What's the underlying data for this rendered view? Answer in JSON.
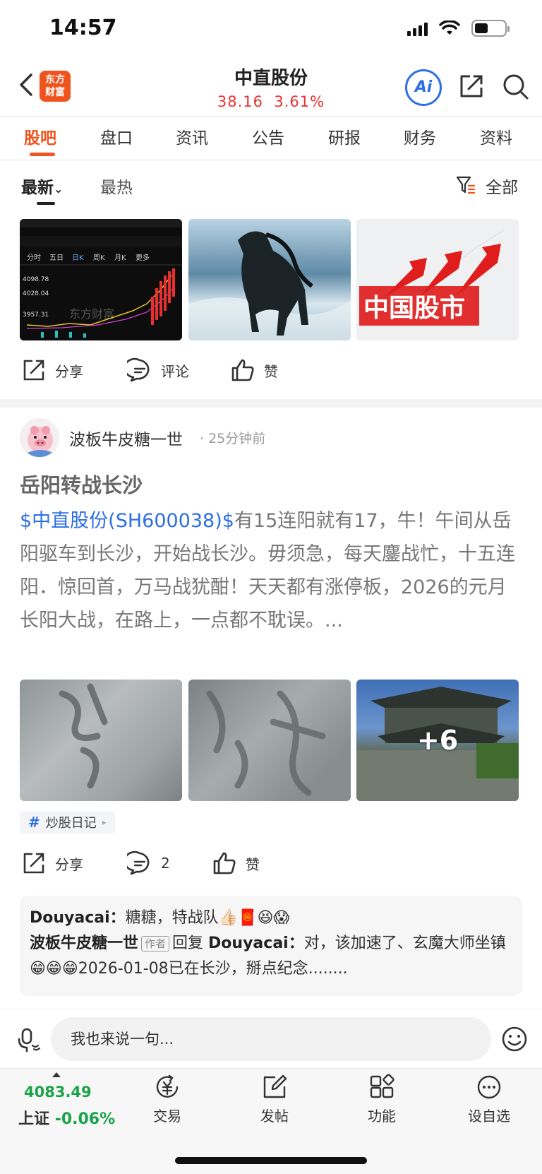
{
  "status_bar": {
    "time": "14:57"
  },
  "header": {
    "logo_text_line1": "东方",
    "logo_text_line2": "财富",
    "stock_name": "中直股份",
    "stock_price": "38.16",
    "stock_change": "3.61%",
    "ai_label": "Ai"
  },
  "tabs": [
    {
      "label": "股吧",
      "active": true
    },
    {
      "label": "盘口"
    },
    {
      "label": "资讯"
    },
    {
      "label": "公告"
    },
    {
      "label": "研报"
    },
    {
      "label": "财务"
    },
    {
      "label": "资料"
    }
  ],
  "sub_filter": {
    "latest": "最新",
    "hot": "最热",
    "all": "全部"
  },
  "post1": {
    "chart_thumb_watermark": "东方财富",
    "chart_thumb_price_high": "4098.78",
    "chart_thumb_price_mid": "4028.04",
    "chart_thumb_price_low": "3957.31",
    "chart_thumb_tabs": [
      "分时",
      "五日",
      "日K",
      "周K",
      "月K",
      "更多"
    ],
    "stock_thumb_title": "中国股市",
    "actions": {
      "share": "分享",
      "comment": "评论",
      "like": "赞"
    }
  },
  "post2": {
    "author": "波板牛皮糖一世",
    "time": "· 25分钟前",
    "title": "岳阳转战长沙",
    "mention": "$中直股份(SH600038)$",
    "body": "有15连阳就有17，牛！午间从岳阳驱车到长沙，开始战长沙。毋须急，每天鏖战忙，十五连阳．惊回首，万马战犹酣！天天都有涨停板，2026的元月长阳大战，在路上，一点都不耽误。...",
    "more_images": "+6",
    "topic": "炒股日记",
    "actions": {
      "share": "分享",
      "comment_count": "2",
      "like": "赞"
    },
    "comments": [
      {
        "user": "Douyacai：",
        "text": "糖糖，特战队👍🏻🧧😆😱"
      },
      {
        "user": "波板牛皮糖一世",
        "badge": "作者",
        "reply_word": "回复",
        "reply_to": "Douyacai：",
        "text": "对，该加速了、玄魔大师坐镇😁😁😁2026-01-08已在长沙，掰点纪念........"
      }
    ]
  },
  "comment_input": {
    "placeholder": "我也来说一句..."
  },
  "bottom_nav": {
    "index_value": "4083.49",
    "index_name": "上证",
    "index_change": "-0.06%",
    "items": [
      {
        "label": "交易",
        "icon": "yuan-exchange-icon"
      },
      {
        "label": "发帖",
        "icon": "compose-icon"
      },
      {
        "label": "功能",
        "icon": "grid-icon"
      },
      {
        "label": "设自选",
        "icon": "more-dots-icon"
      }
    ]
  },
  "colors": {
    "brand": "#f0541e",
    "up": "#e8302f",
    "down": "#1aa34a",
    "link": "#2d6ee6"
  }
}
